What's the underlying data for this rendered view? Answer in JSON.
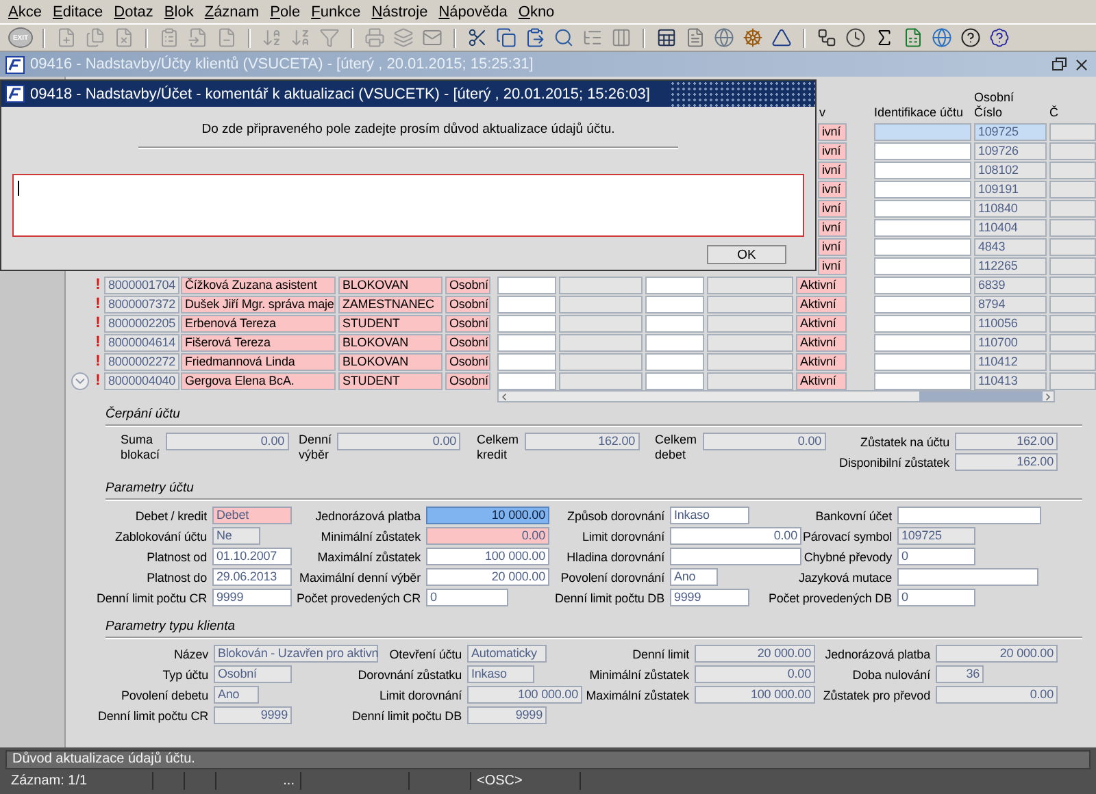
{
  "menu": [
    "Akce",
    "Editace",
    "Dotaz",
    "Blok",
    "Záznam",
    "Pole",
    "Funkce",
    "Nástroje",
    "Nápověda",
    "Okno"
  ],
  "toolbar": {
    "exit": "EXIT"
  },
  "window": {
    "title": "09416 - Nadstavby/Účty klientů (VSUCETA) - [úterý  , 20.01.2015; 15:25:31]"
  },
  "dialog": {
    "title": "09418 - Nadstavby/Účet - komentář k aktualizaci (VSUCETK) - [úterý  , 20.01.2015; 15:26:03]",
    "message": "Do zde připraveného pole zadejte prosím důvod aktualizace údajů účtu.",
    "button": "OK"
  },
  "table": {
    "columns": [
      "v",
      "Identifikace účtu",
      "Osobní Číslo",
      "Č"
    ],
    "rows": [
      {
        "kind": "covered",
        "selected": true,
        "state": "ivní",
        "personal_number": "109725"
      },
      {
        "kind": "covered",
        "selected": false,
        "state": "ivní",
        "personal_number": "109726"
      },
      {
        "kind": "covered",
        "selected": false,
        "state": "ivní",
        "personal_number": "108102"
      },
      {
        "kind": "covered",
        "selected": false,
        "state": "ivní",
        "personal_number": "109191"
      },
      {
        "kind": "covered",
        "selected": false,
        "state": "ivní",
        "personal_number": "110840"
      },
      {
        "kind": "covered",
        "selected": false,
        "state": "ivní",
        "personal_number": "110404"
      },
      {
        "kind": "covered",
        "selected": false,
        "state": "ivní",
        "personal_number": "4843"
      },
      {
        "kind": "covered",
        "selected": false,
        "state": "ivní",
        "personal_number": "112265"
      },
      {
        "kind": "full",
        "selected": false,
        "flag": "!",
        "account": "8000001704",
        "name": "Čížková Zuzana asistent",
        "status": "BLOKOVAN",
        "type": "Osobní",
        "state": "Aktivní",
        "personal_number": "6839"
      },
      {
        "kind": "full",
        "selected": false,
        "flag": "!",
        "account": "8000007372",
        "name": "Dušek Jiří Mgr. správa maje",
        "status": "ZAMESTNANEC",
        "type": "Osobní",
        "state": "Aktivní",
        "personal_number": "8794"
      },
      {
        "kind": "full",
        "selected": false,
        "flag": "!",
        "account": "8000002205",
        "name": "Erbenová Tereza",
        "status": "STUDENT",
        "type": "Osobní",
        "state": "Aktivní",
        "personal_number": "110056"
      },
      {
        "kind": "full",
        "selected": false,
        "flag": "!",
        "account": "8000004614",
        "name": "Fišerová Tereza",
        "status": "BLOKOVAN",
        "type": "Osobní",
        "state": "Aktivní",
        "personal_number": "110700"
      },
      {
        "kind": "full",
        "selected": false,
        "flag": "!",
        "account": "8000002272",
        "name": "Friedmannová Linda",
        "status": "BLOKOVAN",
        "type": "Osobní",
        "state": "Aktivní",
        "personal_number": "110412"
      },
      {
        "kind": "full",
        "selected": false,
        "flag": "!",
        "account": "8000004040",
        "name": "Gergova Elena BcA.",
        "status": "STUDENT",
        "type": "Osobní",
        "state": "Aktivní",
        "personal_number": "110413"
      }
    ]
  },
  "cerpani": {
    "title": "Čerpání účtu",
    "fields": [
      {
        "label": "Suma blokací",
        "value": "0.00",
        "kind": "disabled"
      },
      {
        "label": "Denní výběr",
        "value": "0.00",
        "kind": "disabled"
      },
      {
        "label": "Celkem kredit",
        "value": "162.00",
        "kind": "disabled"
      },
      {
        "label": "Celkem debet",
        "value": "0.00",
        "kind": "disabled"
      },
      {
        "label": "Zůstatek na účtu",
        "value": "162.00",
        "kind": "disabled"
      },
      {
        "label": "Disponibilní zůstatek",
        "value": "162.00",
        "kind": "disabled"
      }
    ]
  },
  "parametry_uctu": {
    "title": "Parametry účtu",
    "fields": [
      {
        "label": "Debet / kredit",
        "value": "Debet",
        "kind": "required"
      },
      {
        "label": "Jednorázová platba",
        "value": "10 000.00",
        "kind": "current"
      },
      {
        "label": "Způsob dorovnání",
        "value": "Inkaso",
        "kind": "normal"
      },
      {
        "label": "Bankovní účet",
        "kind": "normal"
      },
      {
        "label": "Zablokování účtu",
        "value": "Ne",
        "kind": "disabled"
      },
      {
        "label": "Minimální zůstatek",
        "value": "0.00",
        "kind": "required"
      },
      {
        "label": "Limit dorovnání",
        "value": "0.00",
        "kind": "normal"
      },
      {
        "label": "Párovací symbol",
        "value": "109725",
        "kind": "disabled"
      },
      {
        "label": "Platnost od",
        "value": "01.10.2007",
        "kind": "normal"
      },
      {
        "label": "Maximální zůstatek",
        "value": "100 000.00",
        "kind": "normal"
      },
      {
        "label": "Hladina dorovnání",
        "kind": "normal"
      },
      {
        "label": "Chybné převody",
        "value": "0",
        "kind": "normal"
      },
      {
        "label": "Platnost do",
        "value": "29.06.2013",
        "kind": "normal"
      },
      {
        "label": "Maximální denní výběr",
        "value": "20 000.00",
        "kind": "normal"
      },
      {
        "label": "Povolení dorovnání",
        "value": "Ano",
        "kind": "normal"
      },
      {
        "label": "Jazyková mutace",
        "kind": "normal"
      },
      {
        "label": "Denní limit počtu CR",
        "value": "9999",
        "kind": "normal"
      },
      {
        "label": "Počet provedených CR",
        "value": "0",
        "kind": "normal"
      },
      {
        "label": "Denní limit počtu DB",
        "value": "9999",
        "kind": "normal"
      },
      {
        "label": "Počet provedených DB",
        "value": "0",
        "kind": "normal"
      }
    ]
  },
  "parametry_typu_klienta": {
    "title": "Parametry typu klienta",
    "fields": [
      {
        "label": "Název",
        "value": "Blokován - Uzavřen pro aktivn",
        "kind": "disabled"
      },
      {
        "label": "Otevření účtu",
        "value": "Automaticky",
        "kind": "disabled"
      },
      {
        "label": "Denní limit",
        "value": "20 000.00",
        "kind": "disabled"
      },
      {
        "label": "Jednorázová platba",
        "value": "20 000.00",
        "kind": "disabled"
      },
      {
        "label": "Typ účtu",
        "value": "Osobní",
        "kind": "disabled"
      },
      {
        "label": "Dorovnání zůstatku",
        "value": "Inkaso",
        "kind": "disabled"
      },
      {
        "label": "Minimální zůstatek",
        "value": "0.00",
        "kind": "disabled"
      },
      {
        "label": "Doba nulování",
        "value": "36",
        "kind": "disabled"
      },
      {
        "label": "Povolení debetu",
        "value": "Ano",
        "kind": "disabled"
      },
      {
        "label": "Limit dorovnání",
        "value": "100 000.00",
        "kind": "disabled"
      },
      {
        "label": "Maximální zůstatek",
        "value": "100 000.00",
        "kind": "disabled"
      },
      {
        "label": "Zůstatek pro převod",
        "value": "0.00",
        "kind": "disabled"
      },
      {
        "label": "Denní limit počtu CR",
        "value": "9999",
        "kind": "disabled"
      },
      {
        "label": "Denní limit počtu DB",
        "value": "9999",
        "kind": "disabled"
      }
    ]
  },
  "status_bar": {
    "message": "Důvod aktualizace údajů účtu.",
    "record": "Záznam: 1/1",
    "field_3": "...",
    "mode": "<OSC>"
  }
}
